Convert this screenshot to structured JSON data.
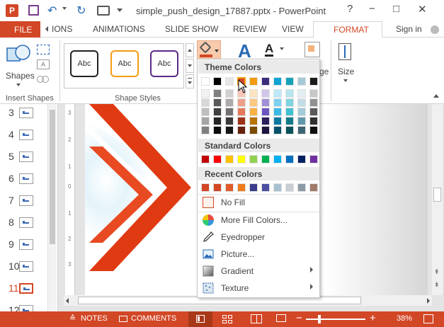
{
  "app": {
    "title": "simple_push_design_17887.pptx - PowerPoint",
    "window_buttons": [
      "?",
      "−",
      "□",
      "✕"
    ]
  },
  "ribbon_tabs": {
    "file": "FILE",
    "tabs": [
      "IONS",
      "ANIMATIONS",
      "SLIDE SHOW",
      "REVIEW",
      "VIEW",
      "FORMAT"
    ],
    "sign_in": "Sign in"
  },
  "ribbon": {
    "shapes_label": "Shapes",
    "insert_shapes_label": "Insert Shapes",
    "shape_styles_label": "Shape Styles",
    "style_samples": [
      "Abc",
      "Abc",
      "Abc"
    ],
    "size_label": "Size",
    "arrange_partial": "ge",
    "colors": {
      "style1": "#222222",
      "style2": "#f39c12",
      "style3": "#5b2a86",
      "fill_swatch": "#f8cbad",
      "accent": "#d24726"
    }
  },
  "thumbnails": [
    {
      "num": "3"
    },
    {
      "num": "4"
    },
    {
      "num": "5"
    },
    {
      "num": "6"
    },
    {
      "num": "7"
    },
    {
      "num": "8"
    },
    {
      "num": "9"
    },
    {
      "num": "10"
    },
    {
      "num": "11",
      "selected": true
    },
    {
      "num": "12"
    }
  ],
  "dropdown": {
    "theme_colors_header": "Theme Colors",
    "standard_colors_header": "Standard Colors",
    "recent_colors_header": "Recent Colors",
    "theme_top": [
      "#ffffff",
      "#000000",
      "#e7e6e6",
      "#d24726",
      "#f39c12",
      "#3c2a7a",
      "#0fa3d6",
      "#17a2b8",
      "#a5c9d6",
      "#1b1b1b"
    ],
    "theme_shades": [
      [
        "#f2f2f2",
        "#7f7f7f",
        "#d0cece",
        "#f6c6b7",
        "#fde4c0",
        "#cfc6ea",
        "#bde8f7",
        "#b8e6ee",
        "#e1eef2",
        "#c8c8c8"
      ],
      [
        "#d8d8d8",
        "#595959",
        "#aeaaaa",
        "#eda18a",
        "#fbc981",
        "#a18ed6",
        "#7cd1ef",
        "#7fd4e0",
        "#c3dde6",
        "#919191"
      ],
      [
        "#bfbfbf",
        "#3f3f3f",
        "#757171",
        "#e47a5b",
        "#f9b145",
        "#6e56bf",
        "#3bbae6",
        "#43c0d0",
        "#a5ccd9",
        "#5a5a5a"
      ],
      [
        "#a5a5a5",
        "#262626",
        "#3a3838",
        "#9d3119",
        "#b87206",
        "#2d1f5b",
        "#0a7aa1",
        "#117a8a",
        "#5e98ab",
        "#303030"
      ],
      [
        "#7f7f7f",
        "#0c0c0c",
        "#171616",
        "#69210f",
        "#7a4c04",
        "#1e143d",
        "#07516b",
        "#0b515c",
        "#3e6573",
        "#0f0f0f"
      ]
    ],
    "standard": [
      "#c00000",
      "#ff0000",
      "#ffc000",
      "#ffff00",
      "#92d050",
      "#00b050",
      "#00b0f0",
      "#0070c0",
      "#002060",
      "#7030a0"
    ],
    "recent": [
      "#d24726",
      "#d24726",
      "#e05a2b",
      "#f07c1e",
      "#3c3c8c",
      "#4a4fa0",
      "#a8c0d0",
      "#c8cdd6",
      "#8c9aa6",
      "#a07a6a"
    ],
    "no_fill": "No Fill",
    "more_fill_colors": "More Fill Colors...",
    "eyedropper": "Eyedropper",
    "picture": "Picture...",
    "gradient": "Gradient",
    "texture": "Texture"
  },
  "status": {
    "notes": "NOTES",
    "comments": "COMMENTS",
    "zoom": "38%"
  },
  "slide": {
    "accent": "#e03a12"
  }
}
